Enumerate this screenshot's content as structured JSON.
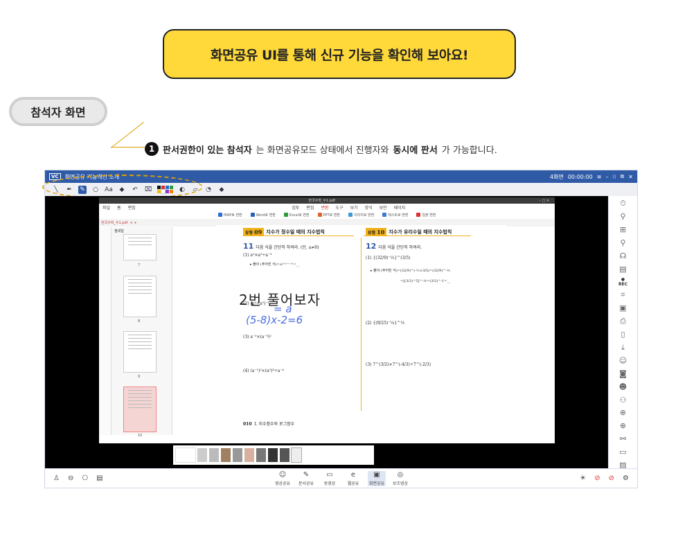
{
  "banner": {
    "title": "화면공유 UI를 통해 신규 기능을 확인해 보아요!"
  },
  "badge": {
    "label": "참석자 화면"
  },
  "callout": {
    "number": "1",
    "part1": "판서권한이 있는 참석자",
    "part2": "는 화면공유모드 상태에서 진행자와 ",
    "part3": "동시에 판서",
    "part4": "가 가능합니다."
  },
  "app": {
    "logo": "VC",
    "title": "화면공유 기능개선 소개",
    "screen_count": "4화면",
    "timer": "00:00:00",
    "tools": [
      "pen",
      "highlighter",
      "pointer",
      "shape",
      "text",
      "fill",
      "undo",
      "clear",
      "palette",
      "eraser",
      "capture",
      "color"
    ],
    "colors": [
      "#111111",
      "#d33030",
      "#1f6fd0",
      "#2a9d3b",
      "#f2c200",
      "#ffffff",
      "#8a3bd0",
      "#ff7f00"
    ]
  },
  "viewer": {
    "title": "한국수학_수1.pdf",
    "menu": [
      "파일",
      "홈",
      "편집"
    ],
    "menu_right": [
      "검토",
      "편집",
      "변환",
      "도구",
      "보기",
      "양식",
      "보안",
      "페이지"
    ],
    "convert": [
      "HWP로 변환",
      "Word로 변환",
      "Excel로 변환",
      "PPT로 변환",
      "이미지로 변환",
      "텍스트로 변환",
      "일괄 변환"
    ],
    "tab": "한국수학_수1.pdf",
    "thumb_label": "썸네일",
    "page_numbers": [
      "7",
      "8",
      "9",
      "10"
    ]
  },
  "doc": {
    "left_tag": "유형",
    "left_no": "09",
    "left_title": "지수가 정수일 때의 지수법칙",
    "right_tag": "유형",
    "right_no": "10",
    "right_title": "지수가 유리수일 때의 지수법칙",
    "q11": "11",
    "q11_text": "다음 식을 간단히 하여라. (단, a≠0)",
    "q12": "12",
    "q12_text": "다음 식을 간단히 하여라.",
    "overlay_text": "2번 풀어보자",
    "handwriting1": "= a",
    "handwriting2": "(5-8)x-2=6",
    "left_items": [
      "(1) a²×a⁵÷a⁻³",
      "▸ 풀이 (주어진 식)=a²⁺⁵⁻⁽⁻³⁾=__",
      "(2) (a³÷a⁵)⁻¹",
      "(3) a⁻²×(a⁻³)²",
      "(4) (a⁻¹)²×(a²)³÷a⁻⁴"
    ],
    "right_items": [
      "(1) {(32/9)⁻⅓}^(3/5)",
      "▸ 풀이 (주어진 식)=(32/9)^(-⅓×3/5)=(32/9)^-⅕",
      "=[(3/2)^5]^-⅕=(3/2)^-1=__",
      "(2) {(9/25)⁻¼}^⅓",
      "(3) 7^(3/2)×7^(-4/3)÷7^(-2/3)"
    ],
    "footer_page": "010",
    "footer_text": "I. 지수함수와 로그함수"
  },
  "bottombar": {
    "center": [
      {
        "icon": "☺",
        "label": "영상공유"
      },
      {
        "icon": "✎",
        "label": "문서공유"
      },
      {
        "icon": "▭",
        "label": "동영상"
      },
      {
        "icon": "e",
        "label": "웹공유"
      },
      {
        "icon": "▣",
        "label": "화면공유"
      },
      {
        "icon": "◎",
        "label": "보조영상"
      }
    ]
  }
}
